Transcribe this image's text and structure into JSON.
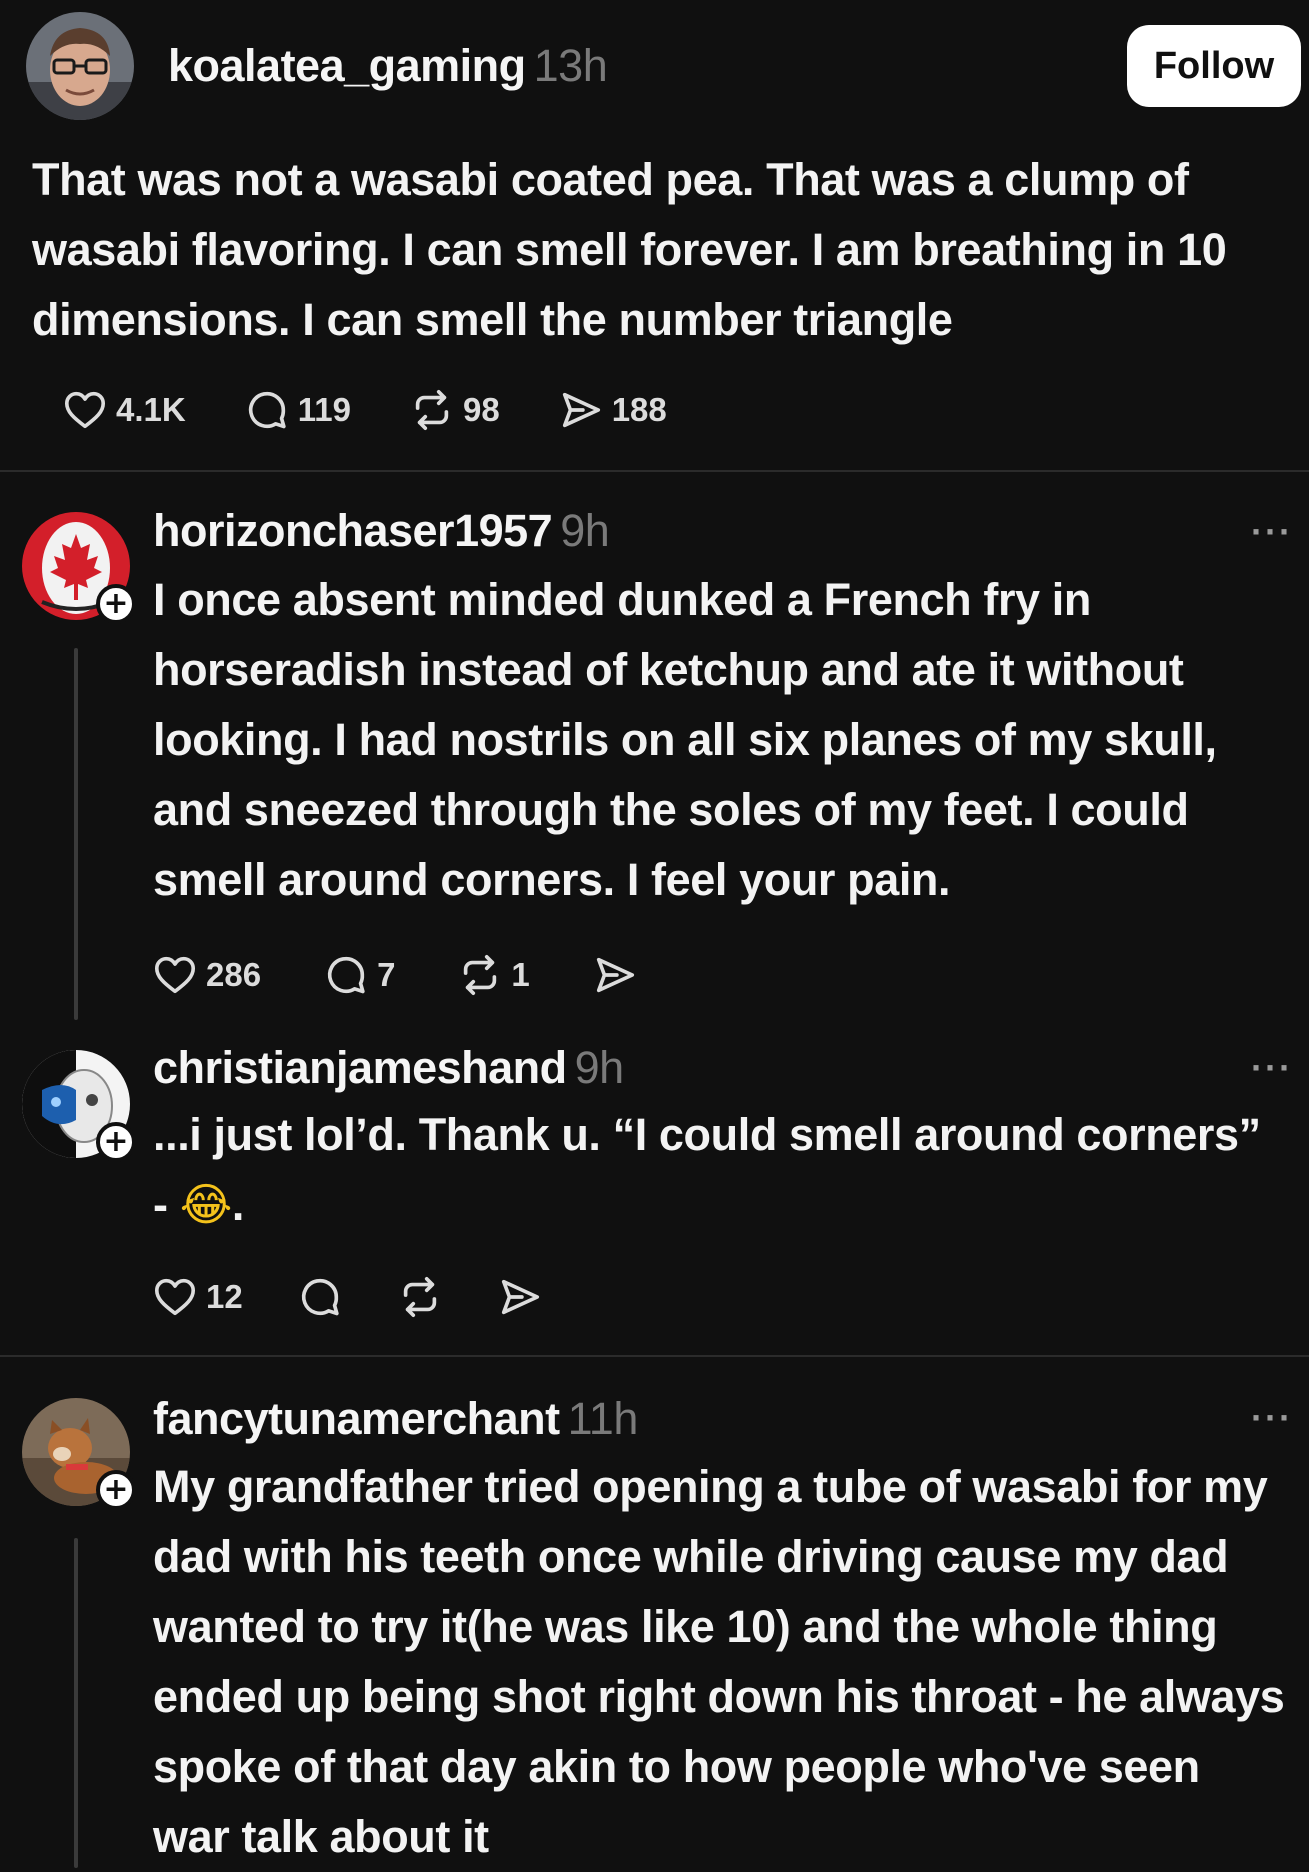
{
  "post": {
    "username": "koalatea_gaming",
    "time": "13h",
    "follow_label": "Follow",
    "text": "That was not a wasabi coated pea. That was a clump of wasabi flavoring. I can smell forever. I am breathing in 10 dimensions. I can smell the number triangle",
    "likes": "4.1K",
    "replies": "119",
    "reposts": "98",
    "shares": "188"
  },
  "replies": [
    {
      "username": "horizonchaser1957",
      "time": "9h",
      "text": "I once absent minded dunked a French fry in horseradish instead of ketchup and ate it without looking. I had nostrils on all six planes of my skull, and sneezed through the soles of my feet. I could smell around corners. I feel your pain.",
      "likes": "286",
      "replies": "7",
      "reposts": "1",
      "more": "···"
    },
    {
      "username": "christianjameshand",
      "time": "9h",
      "text_line1": "...i just lol’d. Thank u. “I could smell around corners”",
      "text_line2_prefix": "- ",
      "emoji": "😂",
      "text_line2_suffix": ".",
      "likes": "12",
      "more": "···"
    },
    {
      "username": "fancytunamerchant",
      "time": "11h",
      "text": "My grandfather tried opening a tube of wasabi for my dad with his teeth once while driving cause my dad wanted to try it(he was like 10) and the whole thing ended up being shot right down his throat - he always spoke of that day akin to how people who've seen war talk about it",
      "more": "···"
    }
  ],
  "icons": [
    "heart-icon",
    "reply-icon",
    "repost-icon",
    "share-icon",
    "plus-icon",
    "more-icon"
  ],
  "colors": {
    "background": "#101010",
    "text": "#f3f3f3",
    "muted": "#7a7a7a",
    "follow_bg": "#ffffff"
  }
}
